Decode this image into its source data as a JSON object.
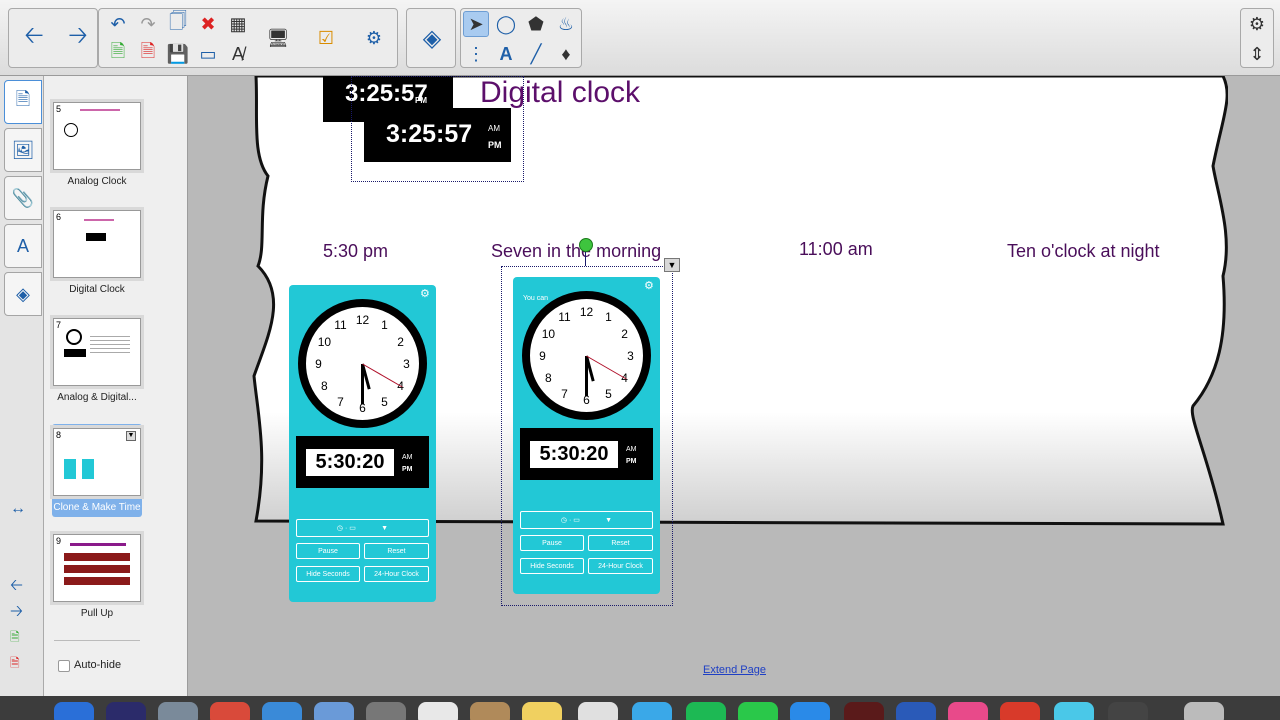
{
  "toolbar": {
    "back_icon": "back-arrow-icon",
    "forward_icon": "forward-arrow-icon"
  },
  "sorter": {
    "pages": [
      {
        "num": "5",
        "caption": "Analog Clock"
      },
      {
        "num": "6",
        "caption": "Digital Clock"
      },
      {
        "num": "7",
        "caption": "Analog & Digital..."
      },
      {
        "num": "8",
        "caption": "Clone & Make Time"
      },
      {
        "num": "9",
        "caption": "Pull Up"
      }
    ],
    "auto_hide_label": "Auto-hide"
  },
  "canvas": {
    "title": "Digital clock",
    "top_clock_time": "3:25:57",
    "top_clock_am": "AM",
    "top_clock_pm": "PM",
    "back_clock_time": "3:25:57",
    "back_clock_pm": "PM",
    "labels": [
      "5:30 pm",
      "Seven in the morning",
      "11:00 am",
      "Ten o'clock at night"
    ],
    "widget1": {
      "time": "5:30:20",
      "am": "AM",
      "pm": "PM",
      "btn_pause": "Pause",
      "btn_reset": "Reset",
      "btn_hide": "Hide Seconds",
      "btn_24": "24-Hour Clock"
    },
    "widget2": {
      "header": "You can                 with your",
      "time": "5:30:20",
      "am": "AM",
      "pm": "PM",
      "btn_pause": "Pause",
      "btn_reset": "Reset",
      "btn_hide": "Hide Seconds",
      "btn_24": "24-Hour Clock"
    },
    "clock_numbers": [
      "12",
      "1",
      "2",
      "3",
      "4",
      "5",
      "6",
      "7",
      "8",
      "9",
      "10",
      "11"
    ],
    "extend_page": "Extend Page"
  },
  "colors": {
    "text_purple": "#5c0f6b",
    "widget_cyan": "#22c8d6",
    "selection_blue": "#7fb1ea"
  }
}
